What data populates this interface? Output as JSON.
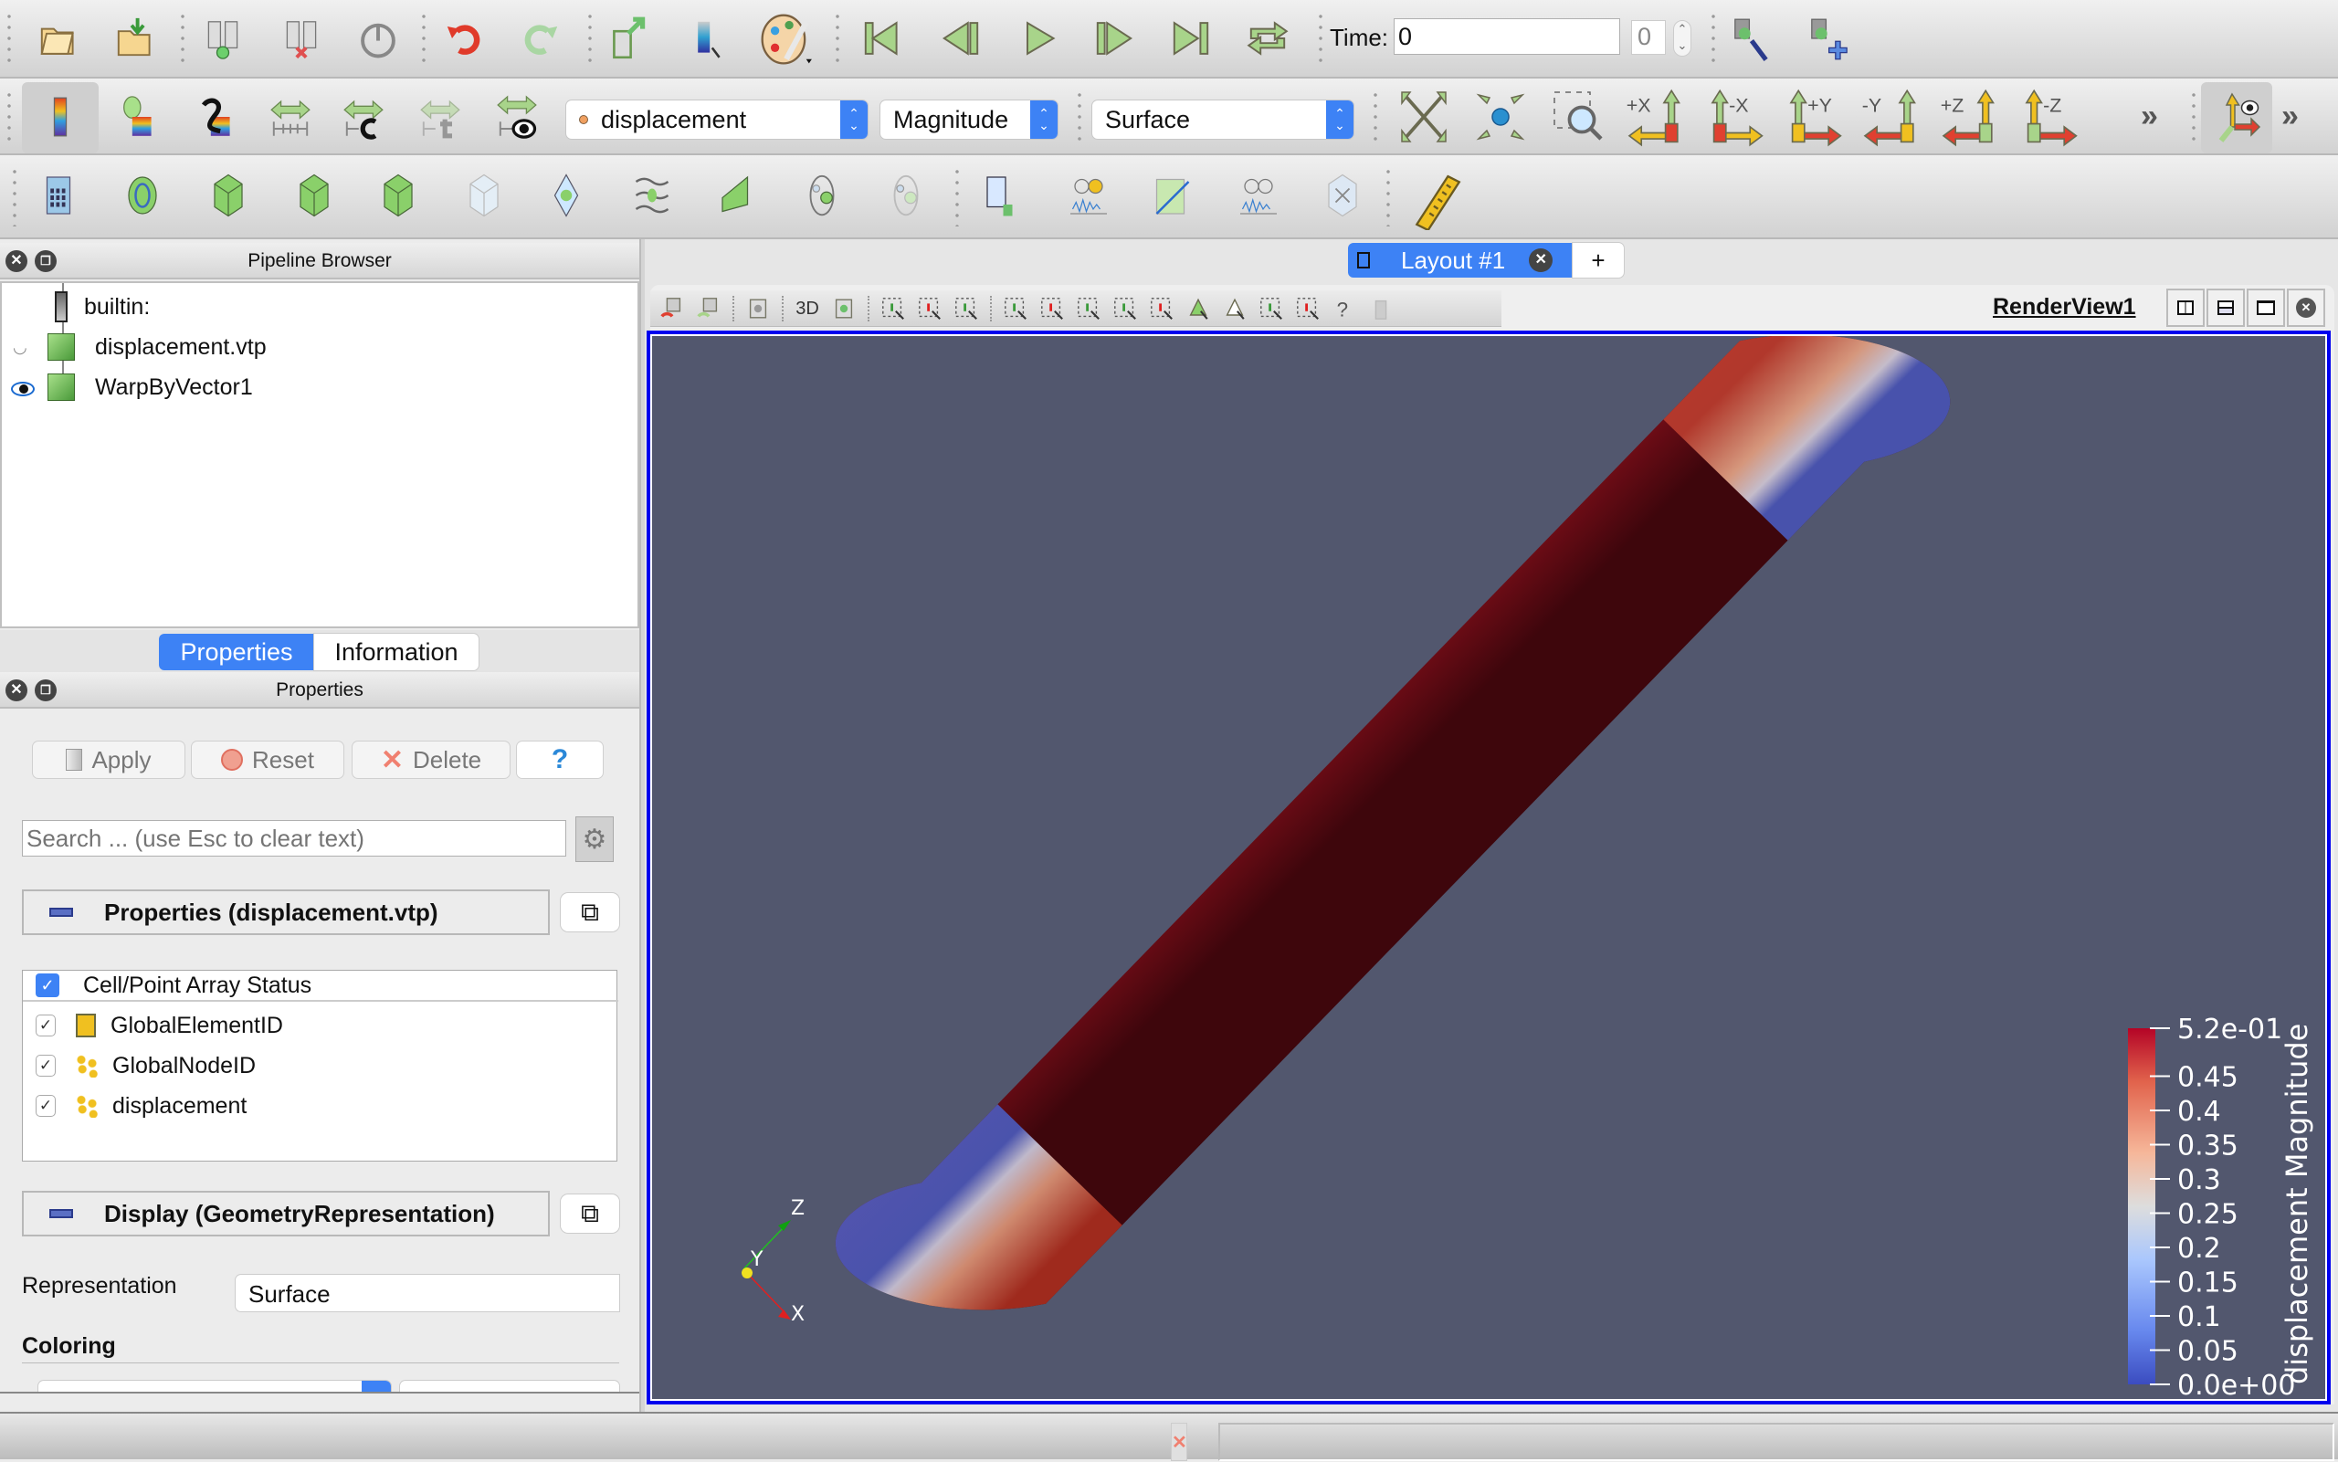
{
  "toolbar_main": {
    "icons": [
      "open-file-icon",
      "load-state-icon",
      "connect-icon",
      "disconnect-icon",
      "reset-session-icon",
      "undo-icon",
      "redo-icon",
      "save-state-icon",
      "color-map-editor-icon",
      "palette-icon"
    ],
    "playback": [
      "first-frame-icon",
      "previous-frame-icon",
      "play-icon",
      "next-frame-icon",
      "last-frame-icon",
      "loop-icon"
    ],
    "time_label": "Time:",
    "time_value": "0",
    "time_index": "0"
  },
  "toolbar_color": {
    "color_array": "displacement",
    "component": "Magnitude",
    "representation": "Surface"
  },
  "toolbar_camera": {
    "buttons": [
      "+X",
      "-X",
      "+Y",
      "-Y",
      "+Z",
      "-Z"
    ],
    "overflow": "»"
  },
  "pipeline_browser": {
    "title": "Pipeline Browser",
    "items": [
      {
        "label": "builtin:",
        "visible": null
      },
      {
        "label": "displacement.vtp",
        "visible": false
      },
      {
        "label": "WarpByVector1",
        "visible": true
      }
    ]
  },
  "tabs": [
    {
      "label": "Properties",
      "active": true
    },
    {
      "label": "Information",
      "active": false
    }
  ],
  "properties_panel": {
    "title": "Properties",
    "apply_label": "Apply",
    "reset_label": "Reset",
    "delete_label": "Delete",
    "help_label": "?",
    "search_placeholder": "Search ... (use Esc to clear text)",
    "section_properties": "Properties (displacement.vtp)",
    "array_status_header": "Cell/Point Array Status",
    "arrays": [
      {
        "name": "GlobalElementID",
        "type": "cell",
        "checked": true
      },
      {
        "name": "GlobalNodeID",
        "type": "point",
        "checked": true
      },
      {
        "name": "displacement",
        "type": "point",
        "checked": true
      }
    ],
    "section_display": "Display (GeometryRepresentation)",
    "representation_label": "Representation",
    "representation_value": "Surface",
    "coloring_label": "Coloring"
  },
  "layout": {
    "tab_label": "Layout #1",
    "add_tab": "+",
    "view_name": "RenderView1",
    "toolbar_3d_label": "3D"
  },
  "render_view": {
    "background": "#52576e",
    "axes": {
      "x": "X",
      "y": "Y",
      "z": "Z"
    }
  },
  "colorbar": {
    "title": "displacement Magnitude",
    "range": [
      0.0,
      0.52
    ],
    "colormap": "Cool to Warm",
    "ticks": [
      "5.2e-01",
      "0.45",
      "0.4",
      "0.35",
      "0.3",
      "0.25",
      "0.2",
      "0.15",
      "0.1",
      "0.05",
      "0.0e+00"
    ],
    "colors": {
      "low": "#3b4cc0",
      "mid": "#dddddd",
      "high": "#b40426"
    }
  },
  "colors": {
    "accent": "#3d82f5",
    "view_border": "#0000ee"
  }
}
